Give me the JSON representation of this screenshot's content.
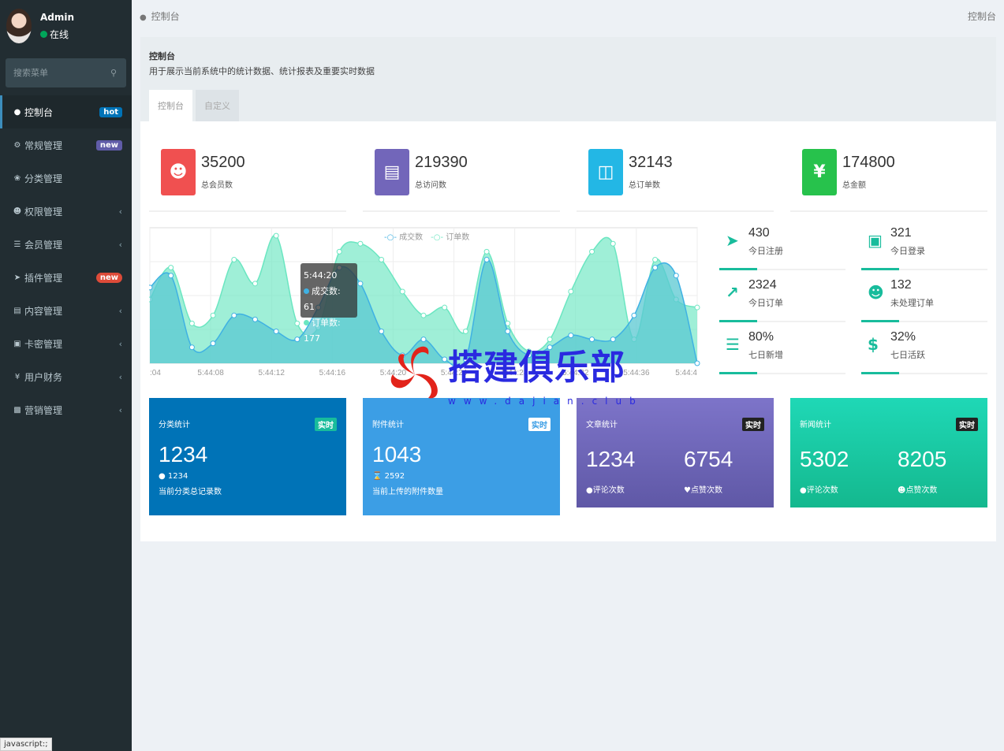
{
  "user": {
    "name": "Admin",
    "status": "在线"
  },
  "search": {
    "placeholder": "搜索菜单"
  },
  "menu": [
    {
      "label": "控制台",
      "icon": "dashboard-icon",
      "badge": "hot"
    },
    {
      "label": "常规管理",
      "icon": "gears-icon",
      "badge": "new"
    },
    {
      "label": "分类管理",
      "icon": "leaf-icon"
    },
    {
      "label": "权限管理",
      "icon": "users-icon",
      "chevron": "‹"
    },
    {
      "label": "会员管理",
      "icon": "list-icon",
      "chevron": "‹"
    },
    {
      "label": "插件管理",
      "icon": "rocket-icon",
      "badge": "new"
    },
    {
      "label": "内容管理",
      "icon": "file-icon",
      "chevron": "‹"
    },
    {
      "label": "卡密管理",
      "icon": "image-icon",
      "chevron": "‹"
    },
    {
      "label": "用户财务",
      "icon": "yen-icon",
      "chevron": "‹"
    },
    {
      "label": "营销管理",
      "icon": "bar-chart-icon",
      "chevron": "‹"
    }
  ],
  "status_bar": "javascript:;",
  "topbar": {
    "breadcrumb": "控制台",
    "right": "控制台"
  },
  "panel": {
    "title": "控制台",
    "desc": "用于展示当前系统中的统计数据、统计报表及重要实时数据",
    "tabs": [
      "控制台",
      "自定义"
    ]
  },
  "stats": [
    {
      "value": "35200",
      "label": "总会员数",
      "color": "#f05050"
    },
    {
      "value": "219390",
      "label": "总访问数",
      "color": "#7266ba"
    },
    {
      "value": "32143",
      "label": "总订单数",
      "color": "#23b7e5"
    },
    {
      "value": "174800",
      "label": "总金额",
      "color": "#27c24c"
    }
  ],
  "mini_stats": [
    {
      "value": "430",
      "label": "今日注册",
      "icon": "rocket-icon"
    },
    {
      "value": "321",
      "label": "今日登录",
      "icon": "cart-icon"
    },
    {
      "value": "2324",
      "label": "今日订单",
      "icon": "line-chart-icon"
    },
    {
      "value": "132",
      "label": "未处理订单",
      "icon": "users-icon"
    },
    {
      "value": "80%",
      "label": "七日新增",
      "icon": "list-icon"
    },
    {
      "value": "32%",
      "label": "七日活跃",
      "icon": "dollar-icon"
    }
  ],
  "tooltip": {
    "time": "5:44:20",
    "line1": "成交数: 61",
    "line2": "订单数: 177"
  },
  "chart_data": {
    "type": "area",
    "legend": [
      "成交数",
      "订单数"
    ],
    "x_ticks": [
      ":04",
      "5:44:08",
      "5:44:12",
      "5:44:16",
      "5:44:20",
      "5:44:24",
      "5:44:28",
      "5:44:32",
      "5:44:36",
      "5:44:4"
    ],
    "series": [
      {
        "name": "成交数",
        "values": [
          95,
          110,
          20,
          25,
          60,
          55,
          40,
          30,
          70,
          120,
          100,
          40,
          10,
          30,
          5,
          5,
          130,
          40,
          10,
          20,
          35,
          30,
          30,
          60,
          120,
          110,
          0
        ]
      },
      {
        "name": "订单数",
        "values": [
          80,
          120,
          50,
          60,
          130,
          100,
          160,
          50,
          45,
          140,
          150,
          130,
          90,
          60,
          70,
          40,
          140,
          50,
          15,
          30,
          90,
          140,
          150,
          30,
          130,
          80,
          70
        ]
      }
    ],
    "ylim": [
      0,
      170
    ]
  },
  "boxes": [
    {
      "title": "分类统计",
      "badge": "实时",
      "value": "1234",
      "sub": "1234",
      "foot": "当前分类总记录数"
    },
    {
      "title": "附件统计",
      "badge": "实时",
      "value": "1043",
      "sub": "2592",
      "foot": "当前上传的附件数量"
    },
    {
      "title": "文章统计",
      "badge": "实时",
      "v1": "1234",
      "l1": "评论次数",
      "v2": "6754",
      "l2": "点赞次数"
    },
    {
      "title": "新闻统计",
      "badge": "实时",
      "v1": "5302",
      "l1": "评论次数",
      "v2": "8205",
      "l2": "点赞次数"
    }
  ],
  "watermark": {
    "text": "搭建俱乐部",
    "sub": "www.dajian.club"
  }
}
